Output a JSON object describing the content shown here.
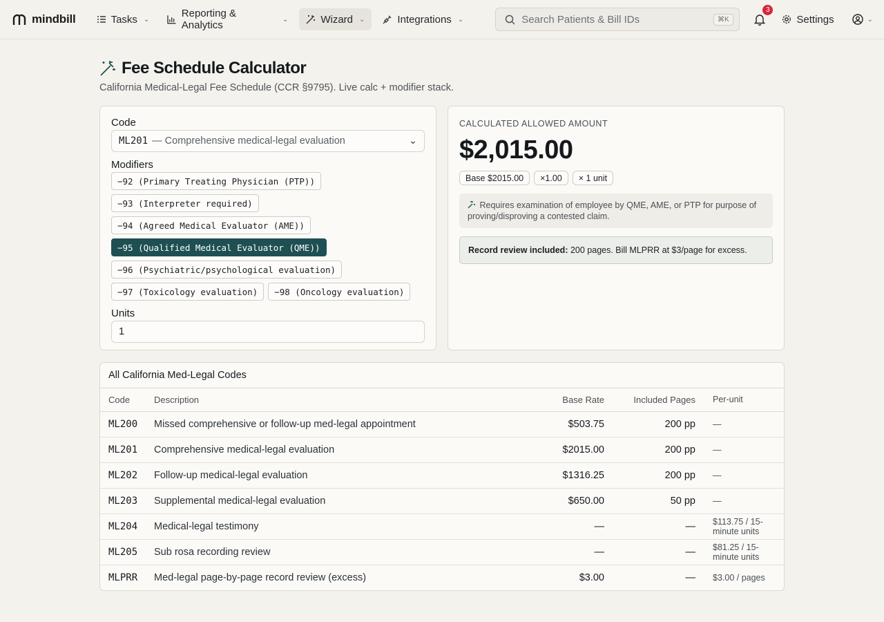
{
  "brand": {
    "name": "mindbill"
  },
  "nav": [
    {
      "label": "Tasks",
      "icon": "list-icon"
    },
    {
      "label": "Reporting & Analytics",
      "icon": "bar-chart-icon"
    },
    {
      "label": "Wizard",
      "icon": "magic-wand-icon",
      "active": true
    },
    {
      "label": "Integrations",
      "icon": "plug-icon"
    }
  ],
  "search": {
    "placeholder": "Search Patients & Bill IDs",
    "shortcut": "⌘K"
  },
  "notifications": {
    "count": "3"
  },
  "settings": {
    "label": "Settings"
  },
  "page": {
    "title": "Fee Schedule Calculator",
    "subtitle": "California Medical-Legal Fee Schedule (CCR §9795). Live calc + modifier stack."
  },
  "calculator": {
    "code_label": "Code",
    "code_value": "ML201",
    "code_desc": "— Comprehensive medical-legal evaluation",
    "modifiers_label": "Modifiers",
    "modifiers": [
      {
        "label": "−92 (Primary Treating Physician (PTP))",
        "selected": false
      },
      {
        "label": "−93 (Interpreter required)",
        "selected": false
      },
      {
        "label": "−94 (Agreed Medical Evaluator (AME))",
        "selected": false
      },
      {
        "label": "−95 (Qualified Medical Evaluator (QME))",
        "selected": true
      },
      {
        "label": "−96 (Psychiatric/psychological evaluation)",
        "selected": false
      },
      {
        "label": "−97 (Toxicology evaluation)",
        "selected": false
      },
      {
        "label": "−98 (Oncology evaluation)",
        "selected": false
      }
    ],
    "units_label": "Units",
    "units_value": "1"
  },
  "result": {
    "label": "CALCULATED ALLOWED AMOUNT",
    "amount": "$2,015.00",
    "pills": [
      "Base $2015.00",
      "×1.00",
      "× 1 unit"
    ],
    "note": "Requires examination of employee by QME, AME, or PTP for purpose of proving/disproving a contested claim.",
    "record_bold": "Record review included:",
    "record_text": " 200 pages. Bill MLPRR at $3/page for excess."
  },
  "table": {
    "title": "All California Med-Legal Codes",
    "headers": [
      "Code",
      "Description",
      "Base Rate",
      "Included Pages",
      "Per-unit"
    ],
    "rows": [
      [
        "ML200",
        "Missed comprehensive or follow-up med-legal appointment",
        "$503.75",
        "200 pp",
        "—"
      ],
      [
        "ML201",
        "Comprehensive medical-legal evaluation",
        "$2015.00",
        "200 pp",
        "—"
      ],
      [
        "ML202",
        "Follow-up medical-legal evaluation",
        "$1316.25",
        "200 pp",
        "—"
      ],
      [
        "ML203",
        "Supplemental medical-legal evaluation",
        "$650.00",
        "50 pp",
        "—"
      ],
      [
        "ML204",
        "Medical-legal testimony",
        "—",
        "—",
        "$113.75 / 15-minute units"
      ],
      [
        "ML205",
        "Sub rosa recording review",
        "—",
        "—",
        "$81.25 / 15-minute units"
      ],
      [
        "MLPRR",
        "Med-legal page-by-page record review (excess)",
        "$3.00",
        "—",
        "$3.00 / pages"
      ]
    ]
  },
  "colors": {
    "accent": "#1e4f52",
    "badge": "#d6263a",
    "background": "#f4f2ec"
  }
}
